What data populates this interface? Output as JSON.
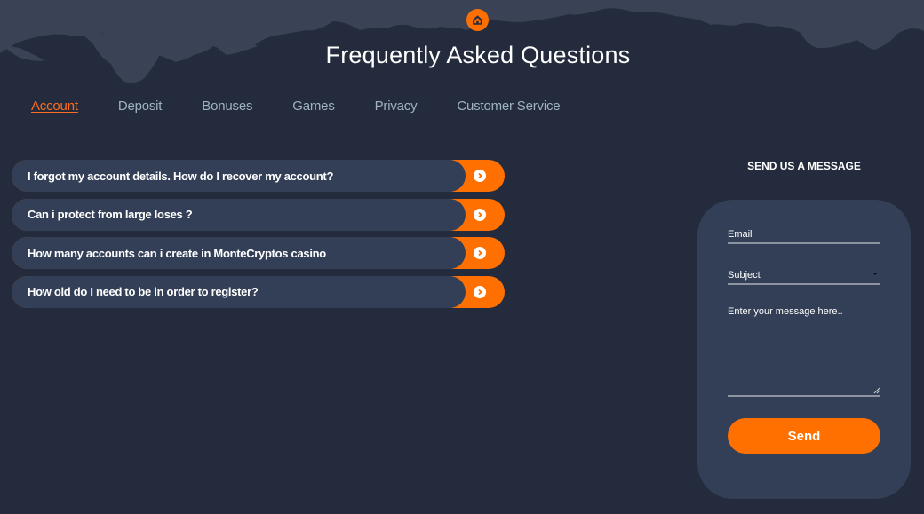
{
  "header": {
    "home_icon": "home-icon",
    "title": "Frequently Asked Questions"
  },
  "tabs": [
    {
      "label": "Account",
      "active": true
    },
    {
      "label": "Deposit",
      "active": false
    },
    {
      "label": "Bonuses",
      "active": false
    },
    {
      "label": "Games",
      "active": false
    },
    {
      "label": "Privacy",
      "active": false
    },
    {
      "label": "Customer Service",
      "active": false
    }
  ],
  "faq": {
    "items": [
      {
        "question": "I forgot my account details. How do I recover my account?",
        "icon": "chevron-right-circle-icon"
      },
      {
        "question": "Can i protect from large loses ?",
        "icon": "chevron-right-circle-icon"
      },
      {
        "question": "How many accounts can i create in MonteCryptos casino",
        "icon": "chevron-right-circle-icon"
      },
      {
        "question": "How old do I need to be in order to register?",
        "icon": "chevron-right-circle-icon"
      }
    ]
  },
  "contact": {
    "title": "SEND US A MESSAGE",
    "email_placeholder": "Email",
    "subject_selected": "Subject",
    "message_placeholder": "Enter your message here..",
    "send_label": "Send"
  },
  "colors": {
    "background": "#232b3c",
    "panel": "#333f56",
    "accent": "#ff7000",
    "tab_text": "#9fb3bf",
    "tab_active": "#ff6d1f"
  }
}
